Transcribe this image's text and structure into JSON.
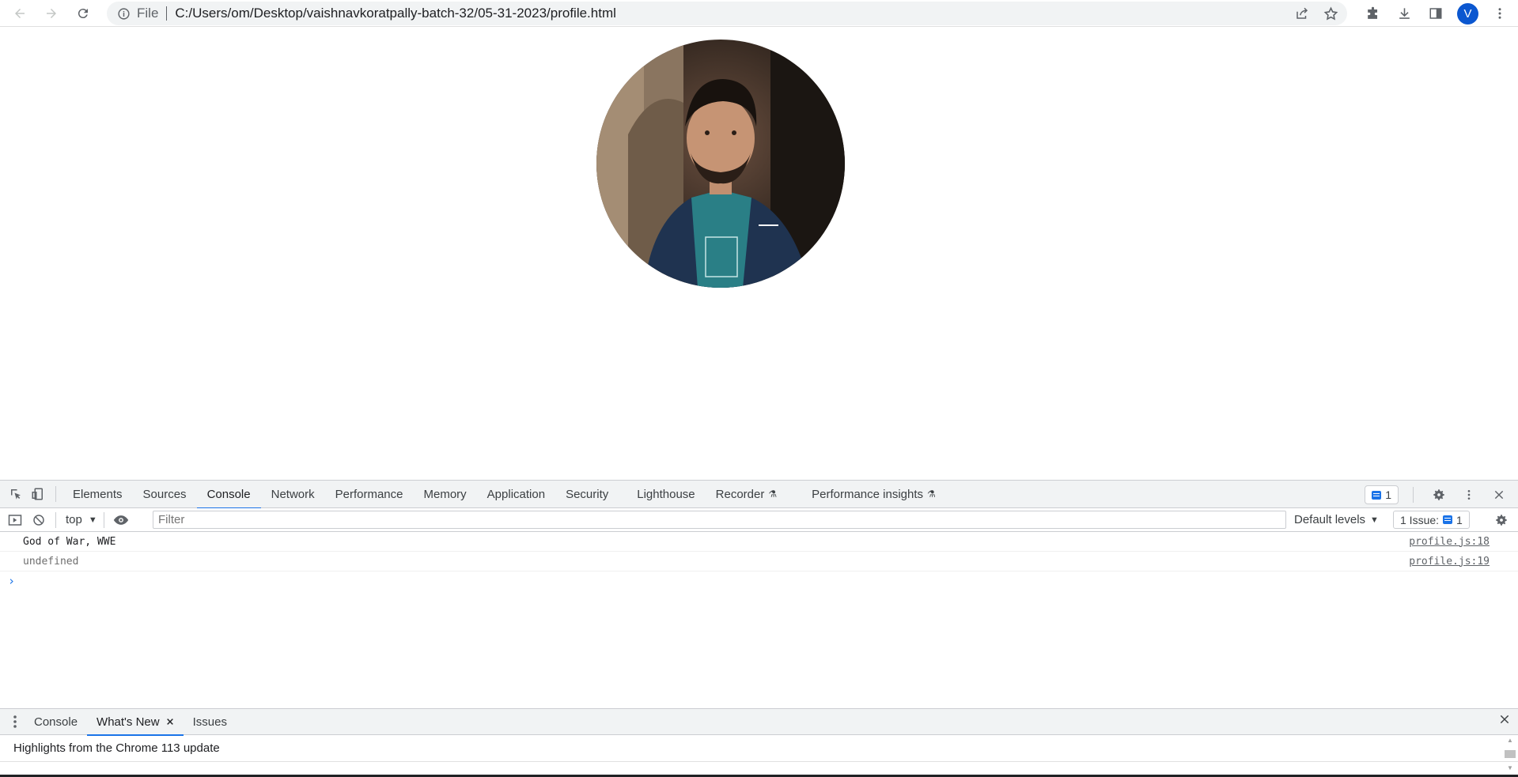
{
  "browser": {
    "address": {
      "scheme_label": "File",
      "url": "C:/Users/om/Desktop/vaishnavkoratpally-batch-32/05-31-2023/profile.html"
    },
    "avatar_letter": "V",
    "accent_color": "#0b57d0"
  },
  "page": {
    "profile_photo": {
      "shape": "circle",
      "icon": "profile-photo"
    }
  },
  "devtools": {
    "tabs": [
      {
        "label": "Elements"
      },
      {
        "label": "Sources"
      },
      {
        "label": "Console",
        "active": true
      },
      {
        "label": "Network"
      },
      {
        "label": "Performance"
      },
      {
        "label": "Memory"
      },
      {
        "label": "Application"
      },
      {
        "label": "Security"
      },
      {
        "label": "Lighthouse"
      },
      {
        "label": "Recorder",
        "icon": "flask-icon"
      },
      {
        "label": "Performance insights",
        "icon": "flask-icon"
      }
    ],
    "issues_badge_count": "1",
    "console_toolbar": {
      "context": "top",
      "filter_placeholder": "Filter",
      "levels": "Default levels",
      "issues_label": "1 Issue:",
      "issues_count": "1"
    },
    "console_messages": [
      {
        "text": "God of War, WWE",
        "source": "profile.js:18"
      },
      {
        "text": "undefined",
        "source": "profile.js:19"
      }
    ],
    "prompt_symbol": "›",
    "drawer": {
      "tabs": [
        {
          "label": "Console"
        },
        {
          "label": "What's New",
          "active": true,
          "closable": true
        },
        {
          "label": "Issues"
        }
      ],
      "body_text": "Highlights from the Chrome 113 update"
    },
    "accent_color": "#1a73e8"
  }
}
